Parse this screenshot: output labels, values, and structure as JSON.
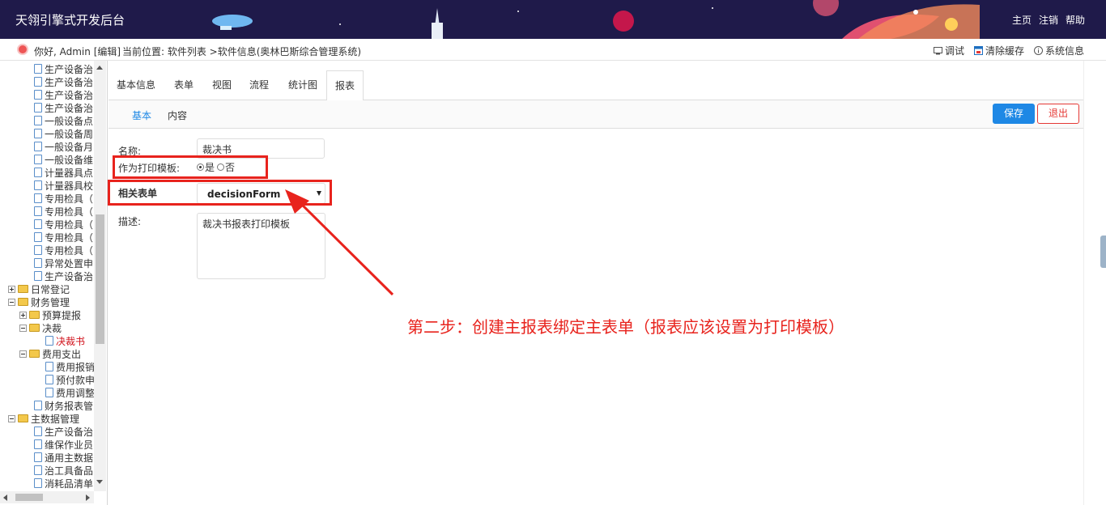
{
  "header": {
    "app_title": "天翎引擎式开发后台",
    "nav": [
      "主页",
      "注销",
      "帮助"
    ],
    "colors": {
      "banner_bg": "#1f1a4a",
      "accent": "#1e88e5",
      "danger": "#e53935",
      "annotation": "#e8231d"
    }
  },
  "subheader": {
    "greeting": "你好, Admin [编辑]",
    "breadcrumb": "当前位置: 软件列表 >软件信息(奥林巴斯综合管理系统)",
    "tools": [
      {
        "icon": "debug-icon",
        "label": "调试"
      },
      {
        "icon": "clear-cache-icon",
        "label": "清除缓存"
      },
      {
        "icon": "info-icon",
        "label": "系统信息"
      }
    ]
  },
  "tree": {
    "items": [
      {
        "label": "生产设备治",
        "type": "file",
        "level": 2
      },
      {
        "label": "生产设备治",
        "type": "file",
        "level": 2
      },
      {
        "label": "生产设备治",
        "type": "file",
        "level": 2
      },
      {
        "label": "生产设备治",
        "type": "file",
        "level": 2
      },
      {
        "label": "一般设备点",
        "type": "file",
        "level": 2
      },
      {
        "label": "一般设备周",
        "type": "file",
        "level": 2
      },
      {
        "label": "一般设备月",
        "type": "file",
        "level": 2
      },
      {
        "label": "一般设备维",
        "type": "file",
        "level": 2
      },
      {
        "label": "计量器具点",
        "type": "file",
        "level": 2
      },
      {
        "label": "计量器具校",
        "type": "file",
        "level": 2
      },
      {
        "label": "专用检具（",
        "type": "file",
        "level": 2
      },
      {
        "label": "专用检具（",
        "type": "file",
        "level": 2
      },
      {
        "label": "专用检具（",
        "type": "file",
        "level": 2
      },
      {
        "label": "专用检具（",
        "type": "file",
        "level": 2
      },
      {
        "label": "专用检具（",
        "type": "file",
        "level": 2
      },
      {
        "label": "异常处置申",
        "type": "file",
        "level": 2
      },
      {
        "label": "生产设备治",
        "type": "file",
        "level": 2
      },
      {
        "label": "日常登记",
        "type": "folder",
        "level": 0,
        "toggle": "plus"
      },
      {
        "label": "财务管理",
        "type": "folder",
        "level": 0,
        "toggle": "minus"
      },
      {
        "label": "预算提报",
        "type": "folder",
        "level": 1,
        "toggle": "plus"
      },
      {
        "label": "决裁",
        "type": "folder",
        "level": 1,
        "toggle": "minus"
      },
      {
        "label": "决裁书",
        "type": "file",
        "level": 3,
        "active": true
      },
      {
        "label": "费用支出",
        "type": "folder",
        "level": 1,
        "toggle": "minus"
      },
      {
        "label": "费用报销",
        "type": "file",
        "level": 3
      },
      {
        "label": "预付款申",
        "type": "file",
        "level": 3
      },
      {
        "label": "费用调整",
        "type": "file",
        "level": 3
      },
      {
        "label": "财务报表管",
        "type": "file",
        "level": 2
      },
      {
        "label": "主数据管理",
        "type": "folder",
        "level": 0,
        "toggle": "minus"
      },
      {
        "label": "生产设备治",
        "type": "file",
        "level": 2
      },
      {
        "label": "维保作业员",
        "type": "file",
        "level": 2
      },
      {
        "label": "通用主数据",
        "type": "file",
        "level": 2
      },
      {
        "label": "治工具备品",
        "type": "file",
        "level": 2
      },
      {
        "label": "消耗品清单",
        "type": "file",
        "level": 2
      }
    ]
  },
  "tabs": [
    {
      "label": "基本信息"
    },
    {
      "label": "表单"
    },
    {
      "label": "视图"
    },
    {
      "label": "流程"
    },
    {
      "label": "统计图"
    },
    {
      "label": "报表",
      "active": true
    }
  ],
  "subtabs": [
    {
      "label": "基本",
      "active": true
    },
    {
      "label": "内容"
    }
  ],
  "buttons": {
    "save": "保存",
    "exit": "退出"
  },
  "form": {
    "name_label": "名称:",
    "name_value": "裁决书",
    "print_template_label": "作为打印模板:",
    "print_yes": "是",
    "print_no": "否",
    "print_selected": "是",
    "related_form_label": "相关表单",
    "related_form_value": "decisionForm",
    "desc_label": "描述:",
    "desc_value": "裁决书报表打印模板"
  },
  "annotation": "第二步：创建主报表绑定主表单（报表应该设置为打印模板）"
}
